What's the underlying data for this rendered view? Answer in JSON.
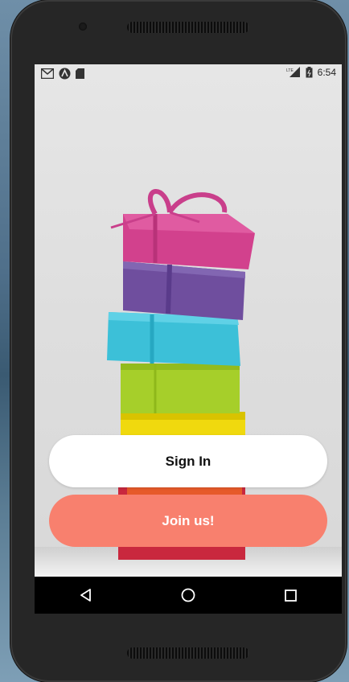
{
  "status_bar": {
    "left_icons": [
      "gmail-icon",
      "android-debug-icon",
      "sd-card-icon"
    ],
    "network_label": "LTE",
    "time": "6:54"
  },
  "buttons": {
    "sign_in": "Sign In",
    "join": "Join us!"
  },
  "colors": {
    "join_button": "#f8806e",
    "sign_in_button": "#ffffff",
    "nav_bar": "#000000"
  },
  "nav_bar": {
    "items": [
      "back-icon",
      "home-icon",
      "recents-icon"
    ]
  }
}
